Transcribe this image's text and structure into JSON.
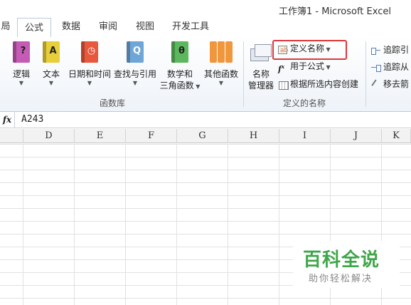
{
  "window": {
    "title": "工作簿1 - Microsoft Excel"
  },
  "tabs": [
    {
      "label": "局",
      "active": false
    },
    {
      "label": "公式",
      "active": true
    },
    {
      "label": "数据",
      "active": false
    },
    {
      "label": "审阅",
      "active": false
    },
    {
      "label": "视图",
      "active": false
    },
    {
      "label": "开发工具",
      "active": false
    }
  ],
  "ribbon": {
    "function_library": {
      "label": "函数库",
      "buttons": [
        {
          "label": "逻辑",
          "icon": "logic-book-icon",
          "glyph": "?",
          "color": "#c55bb5"
        },
        {
          "label": "文本",
          "icon": "text-book-icon",
          "glyph": "A",
          "color": "#e8cf3a"
        },
        {
          "label": "日期和时间",
          "icon": "datetime-book-icon",
          "glyph": "◷",
          "color": "#e8583c"
        },
        {
          "label": "查找与引用",
          "icon": "lookup-book-icon",
          "glyph": "Q",
          "color": "#6fa6d8"
        },
        {
          "label": "数学和",
          "label2": "三角函数",
          "icon": "math-book-icon",
          "glyph": "θ",
          "color": "#5cb85c"
        },
        {
          "label": "其他函数",
          "icon": "more-functions-books-icon",
          "glyph": "",
          "color": "#f0963c"
        }
      ]
    },
    "defined_names": {
      "label": "定义的名称",
      "name_manager": {
        "label": "名称",
        "label2": "管理器"
      },
      "define_name": "定义名称",
      "use_in_formula": "用于公式",
      "create_from_selection": "根据所选内容创建"
    },
    "formula_auditing": {
      "trace_precedents": "追踪引",
      "trace_dependents": "追踪从",
      "remove_arrows": "移去箭"
    }
  },
  "formula_bar": {
    "fx": "fx",
    "value": "A243"
  },
  "columns": [
    "D",
    "E",
    "F",
    "G",
    "H",
    "I",
    "J",
    "K"
  ],
  "watermark": {
    "title": "百科全说",
    "subtitle": "助你轻松解决"
  },
  "colors": {
    "highlight": "#e0363b",
    "watermark_green": "#3fa64a"
  }
}
